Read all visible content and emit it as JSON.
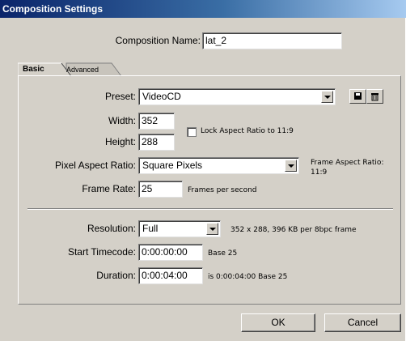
{
  "window": {
    "title": "Composition Settings"
  },
  "composition": {
    "name_label": "Composition Name:",
    "name_value": "lat_2"
  },
  "tabs": [
    {
      "label": "Basic"
    },
    {
      "label": "Advanced"
    }
  ],
  "basic": {
    "preset": {
      "label": "Preset:",
      "value": "VideoCD",
      "save_icon": "floppy-disk-icon",
      "delete_icon": "trash-icon"
    },
    "width": {
      "label": "Width:",
      "value": "352"
    },
    "height": {
      "label": "Height:",
      "value": "288"
    },
    "lock_aspect": {
      "label": "Lock Aspect Ratio to 11:9",
      "checked": false
    },
    "pixel_aspect": {
      "label": "Pixel Aspect Ratio:",
      "value": "Square Pixels"
    },
    "frame_aspect": {
      "label": "Frame Aspect Ratio:",
      "value": "11:9"
    },
    "frame_rate": {
      "label": "Frame Rate:",
      "value": "25",
      "unit": "Frames per second"
    },
    "resolution": {
      "label": "Resolution:",
      "value": "Full",
      "info": "352 x 288, 396 KB per 8bpc frame"
    },
    "start_timecode": {
      "label": "Start Timecode:",
      "value": "0:00:00:00",
      "base": "Base 25"
    },
    "duration": {
      "label": "Duration:",
      "value": "0:00:04:00",
      "info": "is 0:00:04:00  Base 25"
    }
  },
  "buttons": {
    "ok": "OK",
    "cancel": "Cancel"
  },
  "colors": {
    "dialog_bg": "#d4d0c8",
    "titlebar": "#0a246a"
  }
}
